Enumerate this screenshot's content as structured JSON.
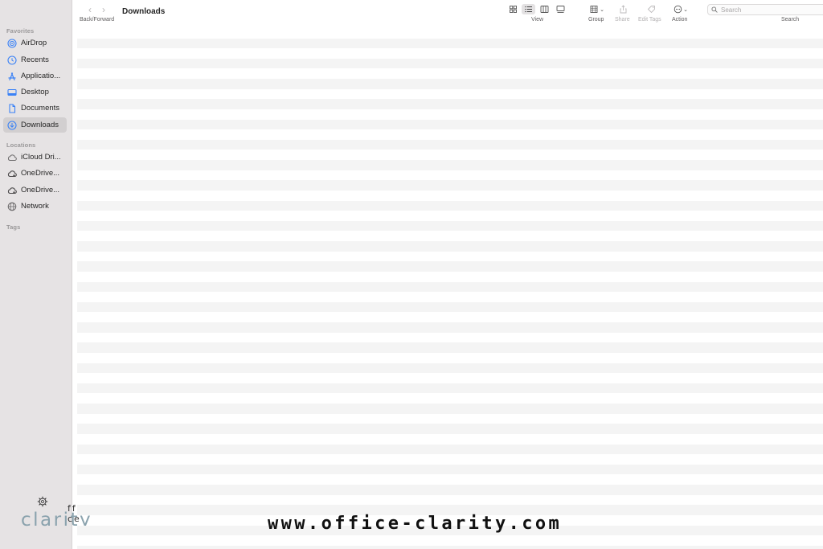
{
  "window": {
    "title": "Downloads"
  },
  "toolbar": {
    "back_forward_label": "Back/Forward",
    "view_label": "View",
    "group_label": "Group",
    "share_label": "Share",
    "edit_tags_label": "Edit Tags",
    "action_label": "Action",
    "search_label": "Search",
    "search_placeholder": "Search",
    "view_modes": [
      "icon-view",
      "list-view",
      "column-view",
      "gallery-view"
    ],
    "active_view": "list-view"
  },
  "sidebar": {
    "sections": [
      {
        "title": "Favorites",
        "items": [
          {
            "label": "AirDrop",
            "icon": "airdrop-icon"
          },
          {
            "label": "Recents",
            "icon": "clock-icon"
          },
          {
            "label": "Applicatio...",
            "icon": "applications-icon"
          },
          {
            "label": "Desktop",
            "icon": "desktop-icon"
          },
          {
            "label": "Documents",
            "icon": "document-icon"
          },
          {
            "label": "Downloads",
            "icon": "download-icon",
            "selected": true
          }
        ]
      },
      {
        "title": "Locations",
        "items": [
          {
            "label": "iCloud Dri...",
            "icon": "cloud-icon"
          },
          {
            "label": "OneDrive...",
            "icon": "onedrive-icon"
          },
          {
            "label": "OneDrive...",
            "icon": "onedrive-icon"
          },
          {
            "label": "Network",
            "icon": "globe-icon"
          }
        ]
      },
      {
        "title": "Tags",
        "items": []
      }
    ]
  },
  "watermark": {
    "logo_top": "ff ce",
    "logo_main": "clarity",
    "site_url": "www.office-clarity.com"
  },
  "colors": {
    "sidebar_bg": "#e6e3e4",
    "selected_item_bg": "#d2cfd0",
    "accent_blue": "#3b82f6",
    "stripe": "#f4f4f4",
    "logo_color": "#8aa2ad"
  }
}
